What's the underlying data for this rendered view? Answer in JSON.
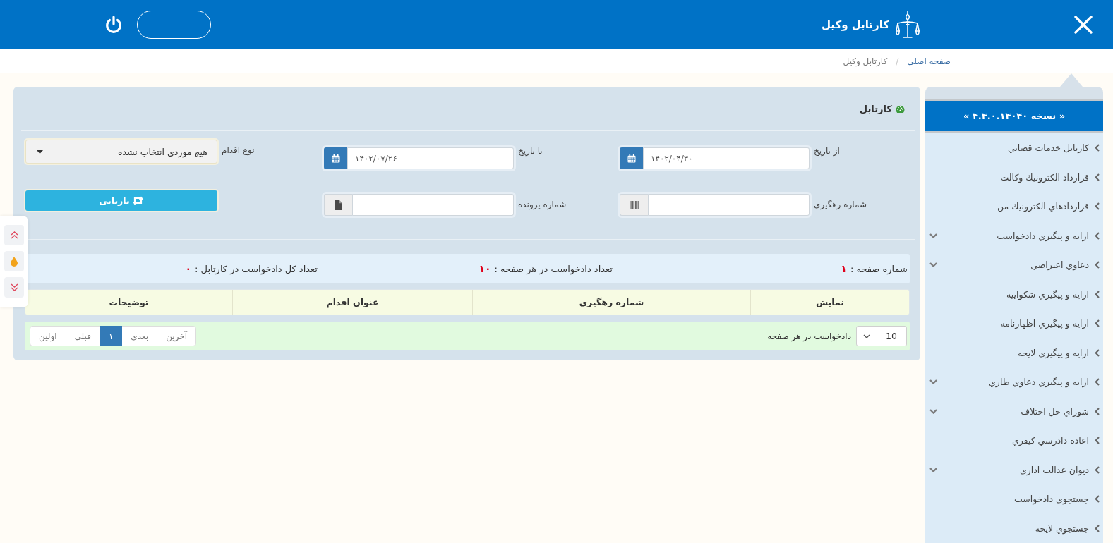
{
  "header": {
    "title": "کارتابل وکیل"
  },
  "breadcrumb": {
    "items": [
      {
        "label": "صفحه اصلی",
        "kind": "link"
      },
      {
        "label": "کارتابل وکیل",
        "kind": "current"
      }
    ],
    "separator": "/"
  },
  "sidebar": {
    "version": "« نسخه ۴.۴.۰.۱۴۰۴۰ »",
    "items": [
      {
        "label": "کارتابل خدمات قضايي",
        "has_submenu": false
      },
      {
        "label": "قرارداد الكترونيك وكالت",
        "has_submenu": false
      },
      {
        "label": "قراردادهاي الكترونيك من",
        "has_submenu": false
      },
      {
        "label": "ارايه و پيگيري دادخواست",
        "has_submenu": true
      },
      {
        "label": "دعاوي اعتراضي",
        "has_submenu": true
      },
      {
        "label": "ارايه و پيگيري شكواييه",
        "has_submenu": false
      },
      {
        "label": "ارايه و پيگيري اظهارنامه",
        "has_submenu": false
      },
      {
        "label": "ارايه و پيگيري لايحه",
        "has_submenu": false
      },
      {
        "label": "ارايه و پيگيري دعاوي طاري",
        "has_submenu": true
      },
      {
        "label": "شوراي حل اختلاف",
        "has_submenu": true
      },
      {
        "label": "اعاده دادرسي كيفري",
        "has_submenu": false
      },
      {
        "label": "ديوان عدالت اداري",
        "has_submenu": true
      },
      {
        "label": "جستجوي دادخواست",
        "has_submenu": false
      },
      {
        "label": "جستجوي لايحه",
        "has_submenu": false
      }
    ]
  },
  "panel": {
    "title": "کارتابل",
    "filters": [
      {
        "kind": "date",
        "label": "از تاریخ",
        "value": "۱۴۰۲/۰۴/۳۰"
      },
      {
        "kind": "date",
        "label": "تا تاریخ",
        "value": "۱۴۰۲/۰۷/۲۶"
      },
      {
        "kind": "select",
        "label": "نوع اقدام",
        "value": "هیچ موردی انتخاب نشده"
      },
      {
        "kind": "barcode",
        "label": "شماره رهگیری"
      },
      {
        "kind": "document",
        "label": "شماره پرونده"
      },
      {
        "kind": "button",
        "label": "بازیابی"
      }
    ],
    "summary": [
      {
        "label": "شماره صفحه :",
        "value": "۱"
      },
      {
        "label": "تعداد دادخواست در هر صفحه :",
        "value": "۱۰"
      },
      {
        "label": "تعداد کل دادخواست در کارتابل :",
        "value": "۰"
      }
    ],
    "table": {
      "columns": [
        "نمایش",
        "شماره رهگیری",
        "عنوان اقدام",
        "توضیحات"
      ]
    },
    "pager": {
      "page_size": "10",
      "page_size_label": "دادخواست در هر صفحه",
      "pages": [
        {
          "label": "آخرین",
          "selected": false
        },
        {
          "label": "بعدی",
          "selected": false
        },
        {
          "label": "۱",
          "selected": true
        },
        {
          "label": "قبلی",
          "selected": false
        },
        {
          "label": "اولین",
          "selected": false
        }
      ]
    }
  }
}
